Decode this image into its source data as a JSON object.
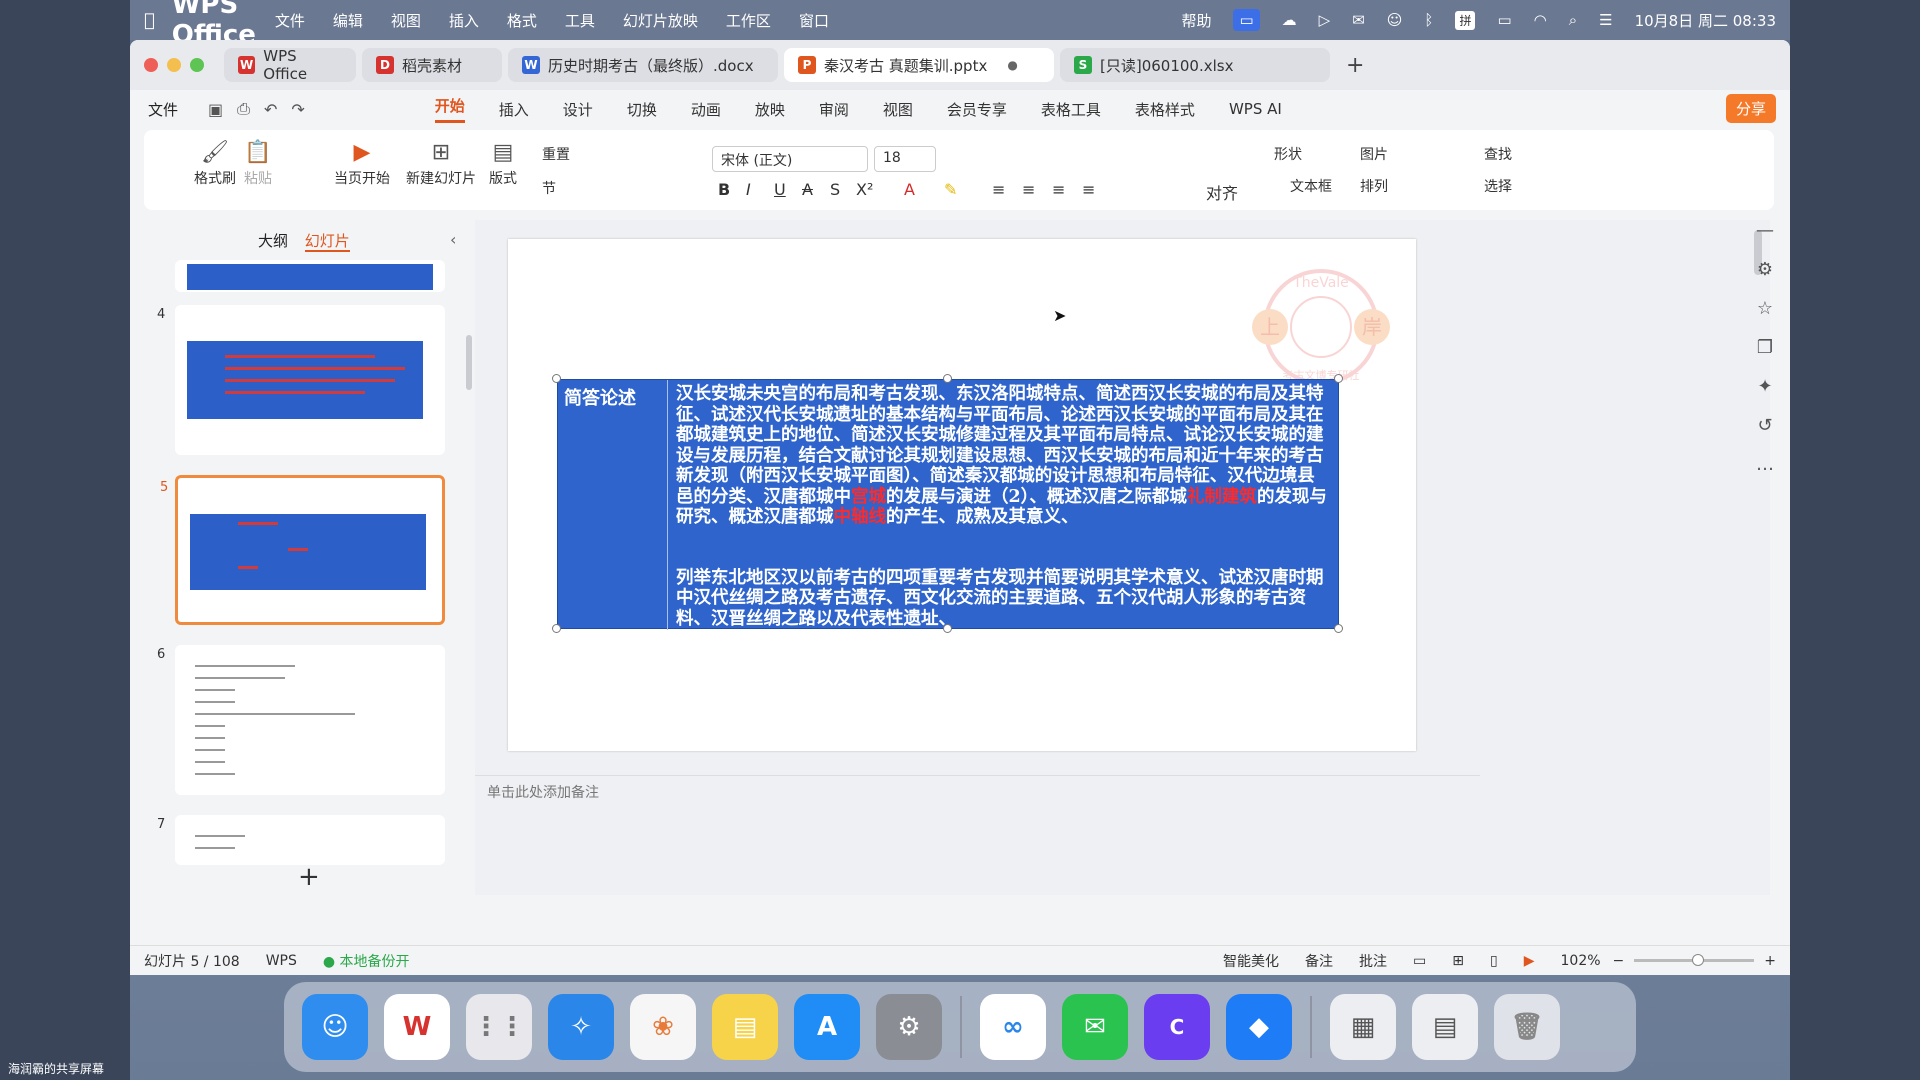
{
  "menubar": {
    "items": [
      "WPS Office",
      "文件",
      "编辑",
      "视图",
      "插入",
      "格式",
      "工具",
      "幻灯片放映",
      "工作区",
      "窗口"
    ],
    "help": "帮助",
    "ime": "拼",
    "datetime": "10月8日 周二 08:33"
  },
  "tabs": [
    {
      "label": "WPS Office",
      "color": "#d6322f",
      "glyph": "W"
    },
    {
      "label": "稻壳素材",
      "color": "#d6322f",
      "glyph": "D"
    },
    {
      "label": "历史时期考古（最终版）.docx",
      "color": "#3566d6",
      "glyph": "W"
    },
    {
      "label": "秦汉考古 真题集训.pptx",
      "color": "#e0561f",
      "glyph": "P"
    },
    {
      "label": "[只读]060100.xlsx",
      "color": "#2ba84a",
      "glyph": "S"
    }
  ],
  "ribbon": {
    "file": "文件",
    "tabs": [
      "开始",
      "插入",
      "设计",
      "切换",
      "动画",
      "放映",
      "审阅",
      "视图",
      "会员专享",
      "表格工具",
      "表格样式"
    ],
    "ai": "WPS AI",
    "share": "分享"
  },
  "toolbar": {
    "format_painter": "格式刷",
    "paste": "粘贴",
    "from_current": "当页开始",
    "new_slide": "新建幻灯片",
    "layout": "版式",
    "reset": "重置",
    "section": "节",
    "font": "宋体 (正文)",
    "size": "18",
    "align": "对齐",
    "shape": "形状",
    "picture": "图片",
    "find": "查找",
    "textbox": "文本框",
    "arrange": "排列",
    "select": "选择"
  },
  "leftpanel": {
    "tab_outline": "大纲",
    "tab_slides": "幻灯片",
    "slide_numbers": [
      "4",
      "5",
      "6",
      "7"
    ]
  },
  "slide": {
    "cell_header": "简答论述",
    "p1_a": "汉长安城未央宫的布局和考古发现、东汉洛阳城特点、简述西汉长安城的布局及其特征、试述汉代长安城遗址的基本结构与平面布局、论述西汉长安城的平面布局及其在都城建筑史上的地位、简述汉长安城修建过程及其平面布局特点、试论汉长安城的建设与发展历程，结合文献讨论其规划建设思想、西汉长安城的布局和近十年来的考古新发现（附西汉长安城平面图）、简述秦汉都城的设计思想和布局特征、汉代边境县邑的分类、汉唐都城中",
    "red1": "宫城",
    "p1_b": "的发展与演进（2）、概述汉唐之际都城",
    "red2": "礼制建筑",
    "p1_c": "的发现与研究、概述汉唐都城",
    "red3": "中轴线",
    "p1_d": "的产生、成熟及其意义、",
    "p2": "列举东北地区汉以前考古的四项重要考古发现并简要说明其学术意义、试述汉唐时期中汉代丝绸之路及考古遗存、西文化交流的主要道路、五个汉代胡人形象的考古资料、汉晋丝绸之路以及代表性遗址、",
    "stamp_top": "TheVale",
    "stamp_left": "上",
    "stamp_right": "岸",
    "stamp_bottom": "考古文博专研社"
  },
  "notes_placeholder": "单击此处添加备注",
  "status": {
    "slide_count": "幻灯片 5 / 108",
    "wps": "WPS",
    "backup": "本地备份开",
    "beautify": "智能美化",
    "notes": "备注",
    "comment": "批注",
    "zoom": "102%"
  },
  "dock_apps": [
    {
      "name": "finder",
      "color": "#2f8df0"
    },
    {
      "name": "wps",
      "color": "#ffffff"
    },
    {
      "name": "launchpad",
      "color": "#e8e8ec"
    },
    {
      "name": "safari",
      "color": "#2a86e8"
    },
    {
      "name": "photos",
      "color": "#f6f6f6"
    },
    {
      "name": "notes",
      "color": "#f7d34a"
    },
    {
      "name": "app-store",
      "color": "#1f8df5"
    },
    {
      "name": "settings",
      "color": "#8a8d94"
    },
    {
      "name": "baidu-netdisk",
      "color": "#ffffff"
    },
    {
      "name": "wechat",
      "color": "#2bc34f"
    },
    {
      "name": "canva",
      "color": "#6a3df0"
    },
    {
      "name": "lark",
      "color": "#1e7cf6"
    }
  ],
  "share_screen_label": "海润霸的共享屏幕"
}
